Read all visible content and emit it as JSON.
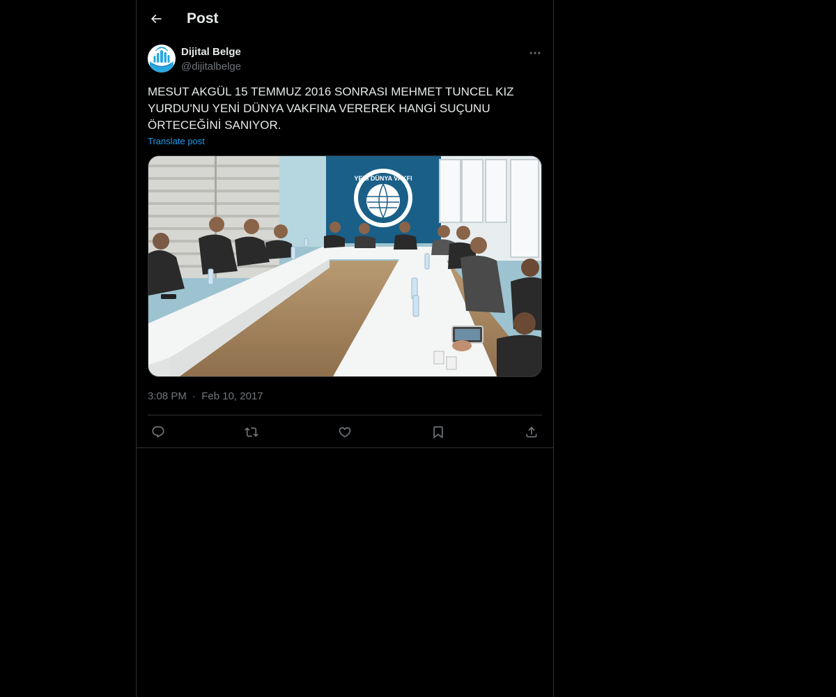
{
  "header": {
    "title": "Post",
    "back_icon": "arrow-left-icon"
  },
  "post": {
    "author": {
      "name": "Dijital Belge",
      "handle": "@dijitalbelge",
      "avatar_icon": "hand-logo-icon"
    },
    "more_icon": "more-horizontal-icon",
    "text": "MESUT AKGÜL 15 TEMMUZ 2016 SONRASI MEHMET TUNCEL KIZ YURDU'NU YENİ DÜNYA VAKFINA VEREREK HANGİ SUÇUNU ÖRTECEĞİNİ SANIYOR.",
    "translate_label": "Translate post",
    "media": {
      "sign_text": "YENİ DÜNYA VAKFI"
    },
    "time": "3:08 PM",
    "separator": "·",
    "date": "Feb 10, 2017",
    "actions": {
      "reply_icon": "reply-icon",
      "repost_icon": "repost-icon",
      "like_icon": "heart-icon",
      "bookmark_icon": "bookmark-icon",
      "share_icon": "share-icon"
    }
  },
  "colors": {
    "background": "#000000",
    "text": "#e7e9ea",
    "secondary": "#71767b",
    "accent": "#1d9bf0",
    "border": "#2f3336"
  }
}
